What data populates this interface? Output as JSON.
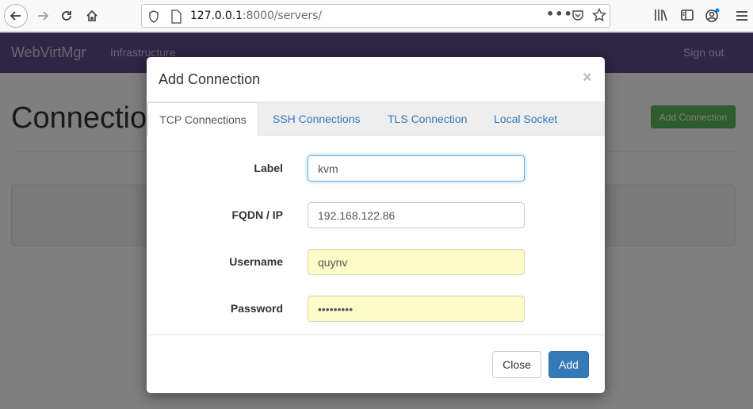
{
  "browser": {
    "url_host": "127.0.0.1",
    "url_rest": ":8000/servers/",
    "menu_dots": "•••"
  },
  "page": {
    "brand": "WebVirtMgr",
    "nav_infrastructure": "Infrastructure",
    "sign_out": "Sign out",
    "title": "Connections",
    "add_connection_button": "Add Connection"
  },
  "modal": {
    "title": "Add Connection",
    "close_symbol": "×",
    "tabs": [
      {
        "label": "TCP Connections",
        "active": true
      },
      {
        "label": "SSH Connections",
        "active": false
      },
      {
        "label": "TLS Connection",
        "active": false
      },
      {
        "label": "Local Socket",
        "active": false
      }
    ],
    "fields": [
      {
        "label": "Label",
        "value": "kvm"
      },
      {
        "label": "FQDN / IP",
        "value": "192.168.122.86"
      },
      {
        "label": "Username",
        "value": "quynv"
      },
      {
        "label": "Password",
        "value": "•••••••••"
      }
    ],
    "close_button": "Close",
    "add_button": "Add"
  },
  "colors": {
    "navbar": "#5f4a8b",
    "primary": "#337ab7",
    "success": "#5cb85c",
    "autofill": "#fdfcc8"
  }
}
